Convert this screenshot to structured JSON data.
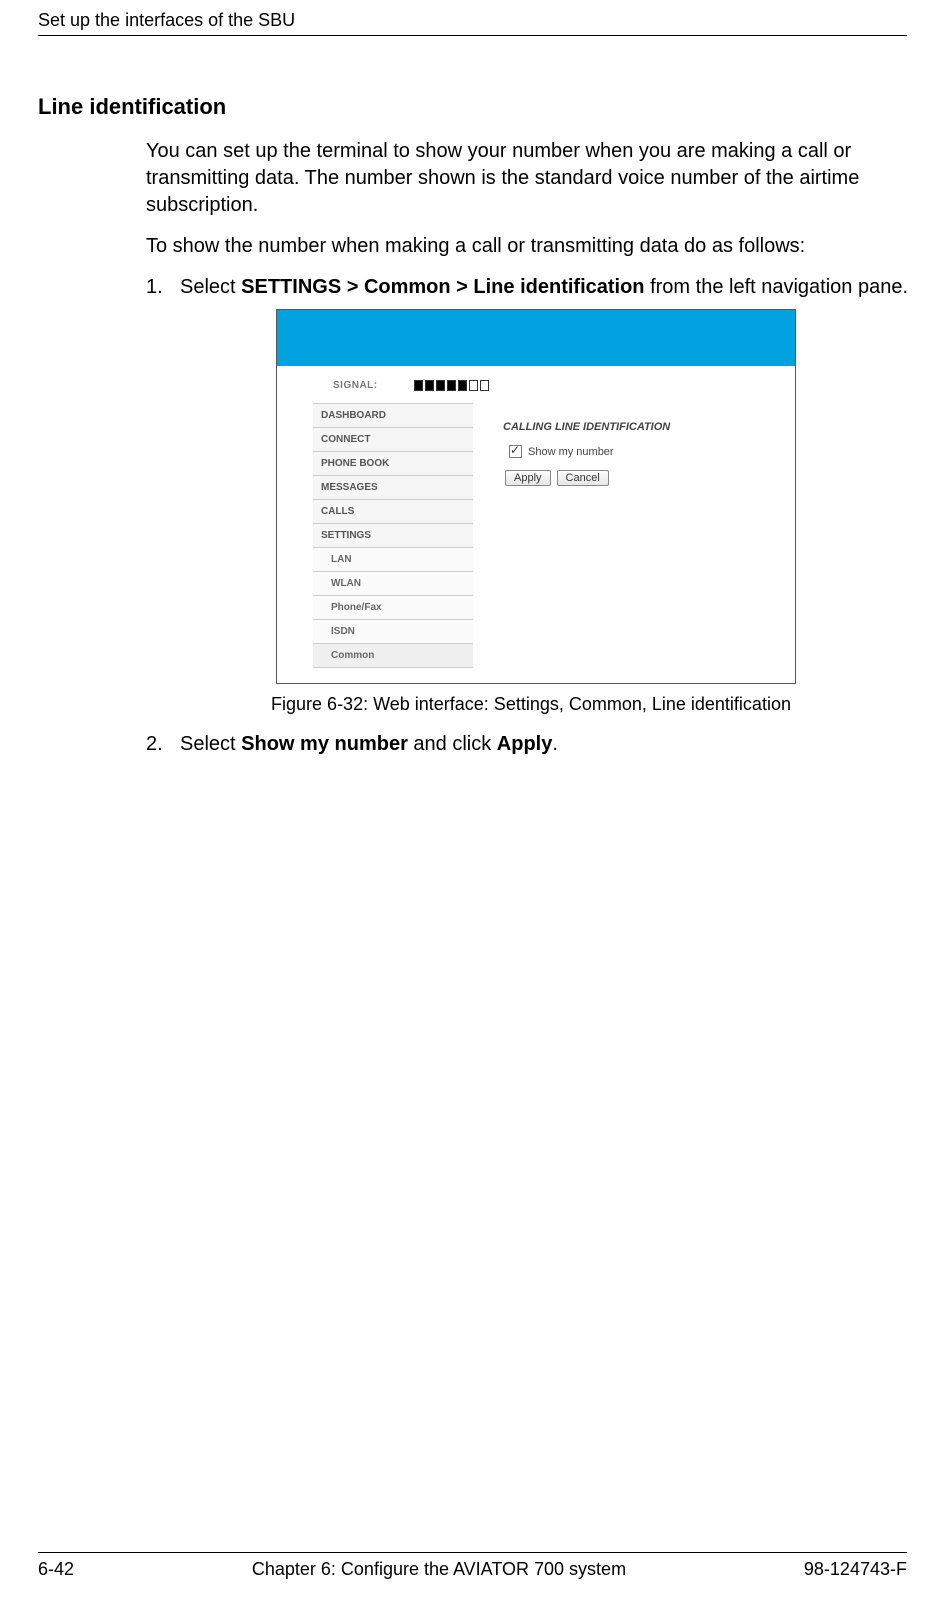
{
  "header": {
    "running": "Set up the interfaces of the SBU"
  },
  "section": {
    "title": "Line identification"
  },
  "paragraphs": {
    "p1": "You can set up the terminal to show your number when you are making a call or transmitting data. The number shown is the standard voice number of the airtime subscription.",
    "p2": "To show the number when making a call or transmitting data do as follows:"
  },
  "steps": {
    "s1": {
      "num": "1.",
      "pre": "Select ",
      "bold": "SETTINGS > Common > Line identification",
      "post": " from the left navigation pane."
    },
    "s2": {
      "num": "2.",
      "pre": "Select ",
      "bold1": "Show my number",
      "mid": " and click ",
      "bold2": "Apply",
      "post": "."
    }
  },
  "figure": {
    "caption": "Figure 6-32: Web interface: Settings, Common, Line identification"
  },
  "screenshot": {
    "signal_label": "SIGNAL:",
    "signal_bars": {
      "filled": 5,
      "empty": 2
    },
    "nav": {
      "items": [
        "DASHBOARD",
        "CONNECT",
        "PHONE BOOK",
        "MESSAGES",
        "CALLS",
        "SETTINGS"
      ],
      "subitems": [
        "LAN",
        "WLAN",
        "Phone/Fax",
        "ISDN",
        "Common"
      ]
    },
    "panel": {
      "title": "CALLING LINE IDENTIFICATION",
      "checkbox_label": "Show my number",
      "buttons": {
        "apply": "Apply",
        "cancel": "Cancel"
      }
    }
  },
  "footer": {
    "left": "6-42",
    "center": "Chapter 6:  Configure the AVIATOR 700 system",
    "right": "98-124743-F"
  }
}
